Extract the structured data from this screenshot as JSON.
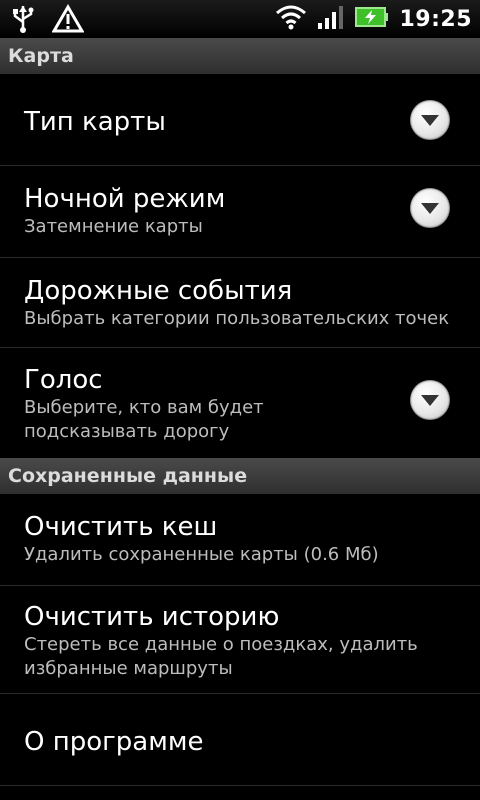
{
  "status_bar": {
    "time": "19:25"
  },
  "sections": [
    {
      "header": "Карта",
      "items": [
        {
          "title": "Тип карты",
          "summary": ""
        },
        {
          "title": "Ночной режим",
          "summary": "Затемнение карты"
        },
        {
          "title": "Дорожные события",
          "summary": "Выбрать категории пользовательских точек"
        },
        {
          "title": "Голос",
          "summary": "Выберите, кто вам будет подсказывать дорогу"
        }
      ]
    },
    {
      "header": "Сохраненные данные",
      "items": [
        {
          "title": "Очистить кеш",
          "summary": "Удалить сохраненные карты (0.6 Мб)"
        },
        {
          "title": "Очистить историю",
          "summary": "Стереть все данные о поездках, удалить избранные маршруты"
        },
        {
          "title": "О программе",
          "summary": ""
        }
      ]
    }
  ]
}
